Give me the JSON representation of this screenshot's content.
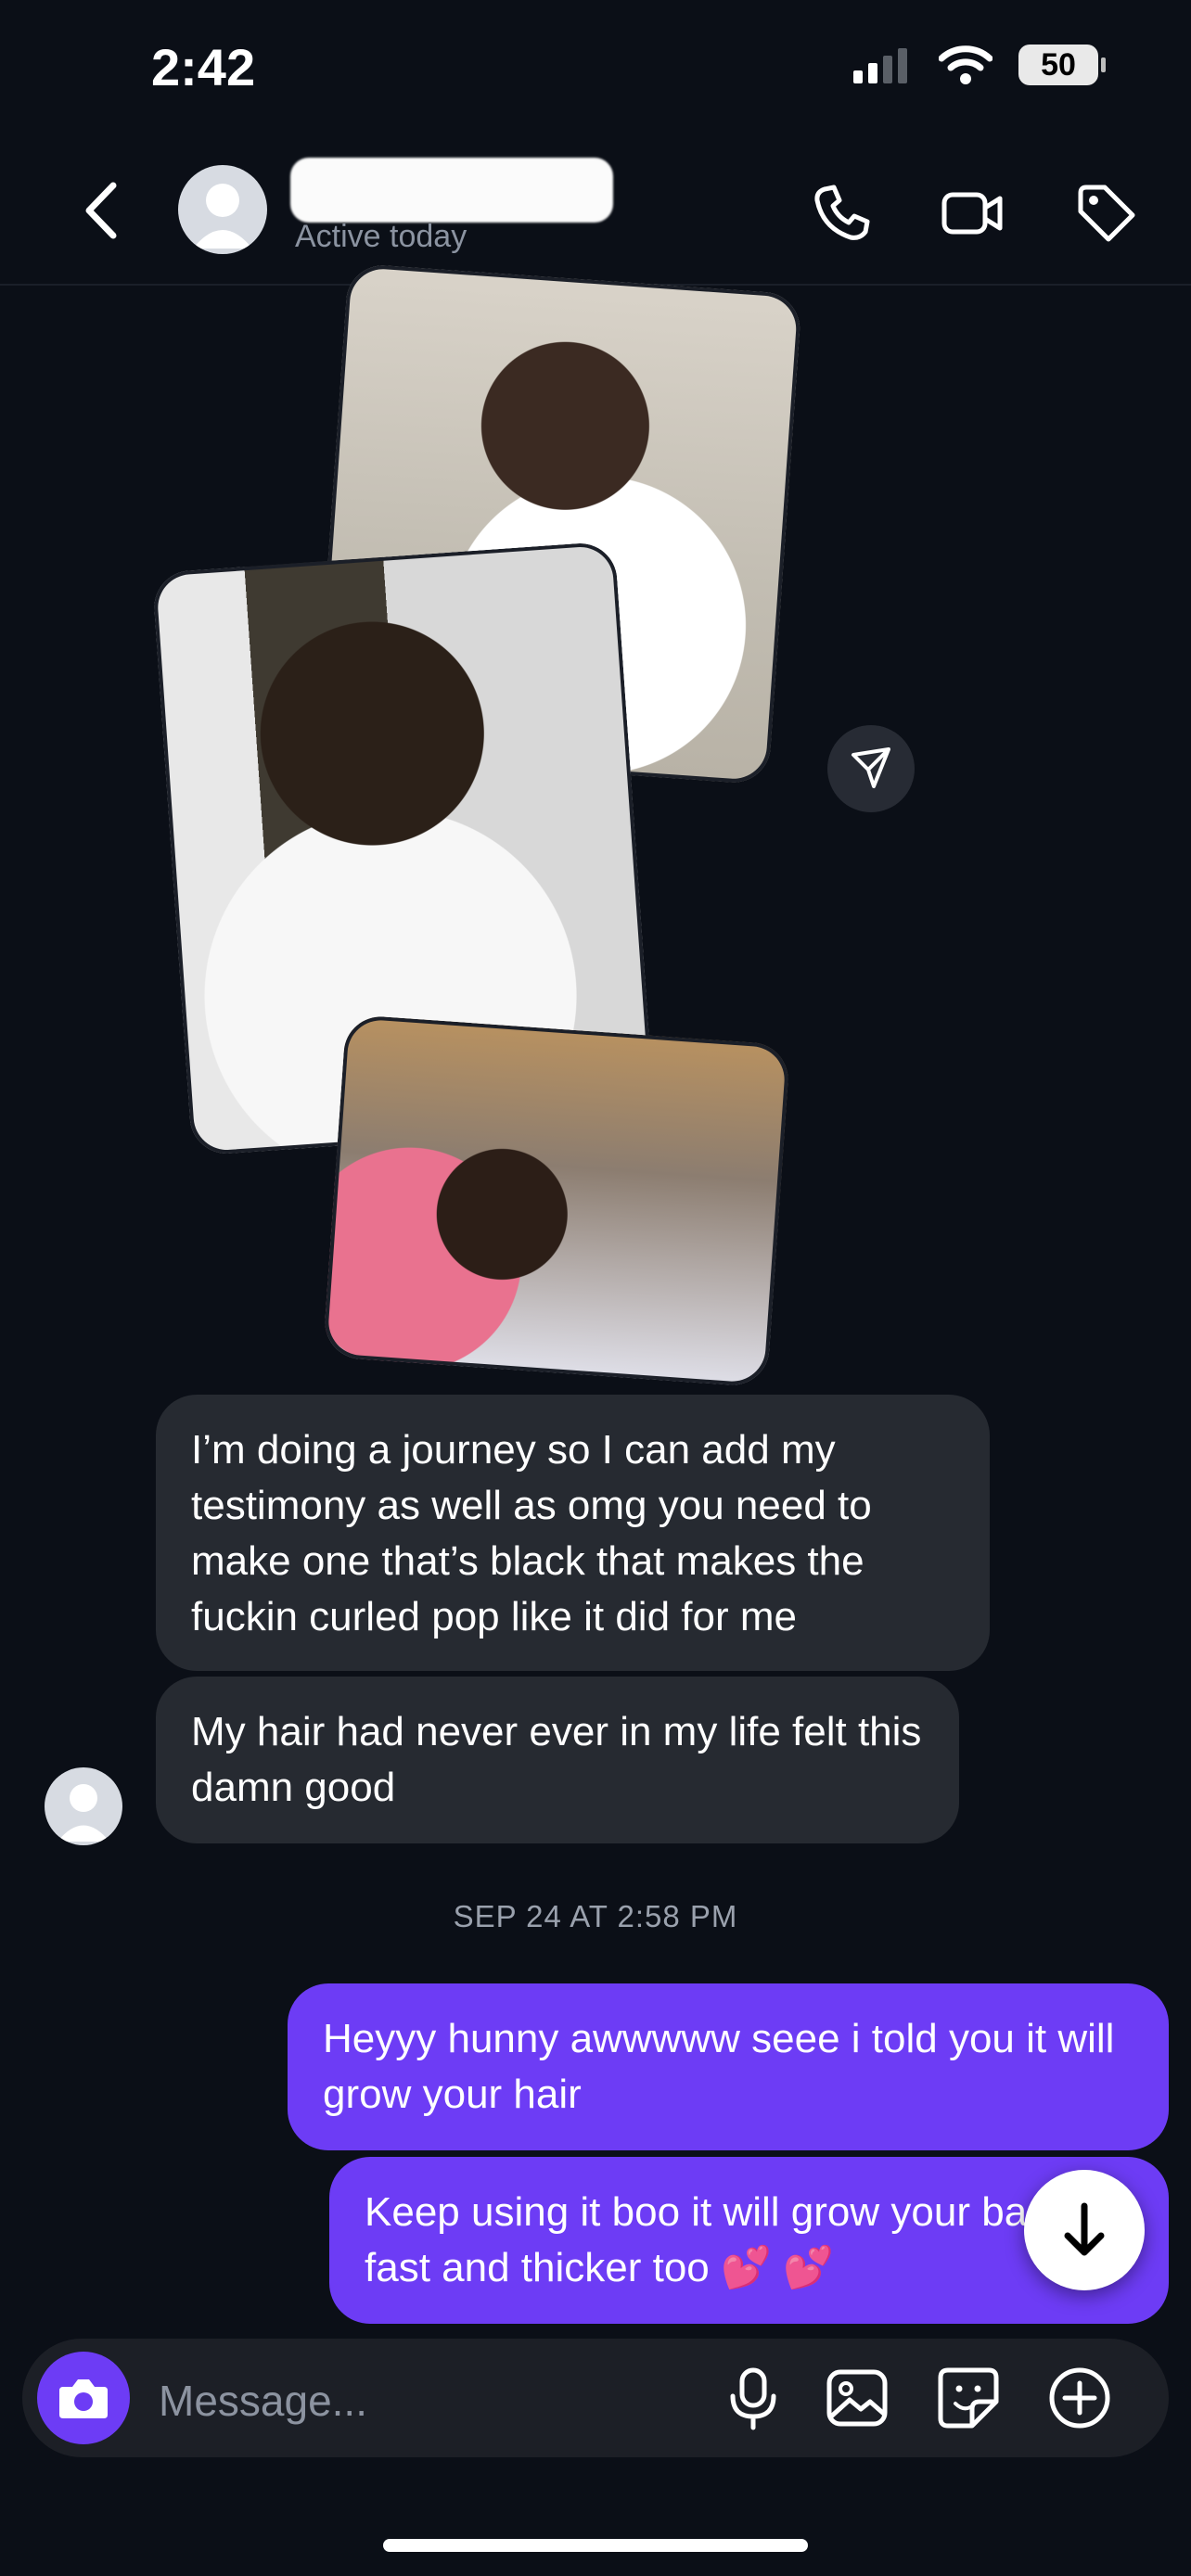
{
  "status": {
    "time": "2:42",
    "battery": "50"
  },
  "header": {
    "active_text": "Active today"
  },
  "messages": {
    "incoming": [
      "I’m doing a journey so I can add my testimony as well as omg you need to make one that’s black that makes the fuckin curled pop like it did for me",
      "My hair had never ever in my life felt this damn good"
    ],
    "timestamp": "SEP 24 AT 2:58 PM",
    "outgoing": [
      "Heyyy hunny awwwww seee i told you it will grow your hair",
      "Keep using it boo it will grow your back fast and thicker too 💕 💕"
    ]
  },
  "composer": {
    "placeholder": "Message..."
  },
  "icons": {
    "back": "chevron-left-icon",
    "phone": "phone-icon",
    "video": "video-icon",
    "tag": "tag-icon",
    "share": "send-icon",
    "scroll": "arrow-down-icon",
    "camera": "camera-icon",
    "mic": "mic-icon",
    "gallery": "image-icon",
    "sticker": "sticker-icon",
    "plus": "plus-circle-icon"
  },
  "colors": {
    "background": "#0b0f17",
    "incoming_bubble": "#262a31",
    "outgoing_bubble": "#6d3cf5"
  }
}
